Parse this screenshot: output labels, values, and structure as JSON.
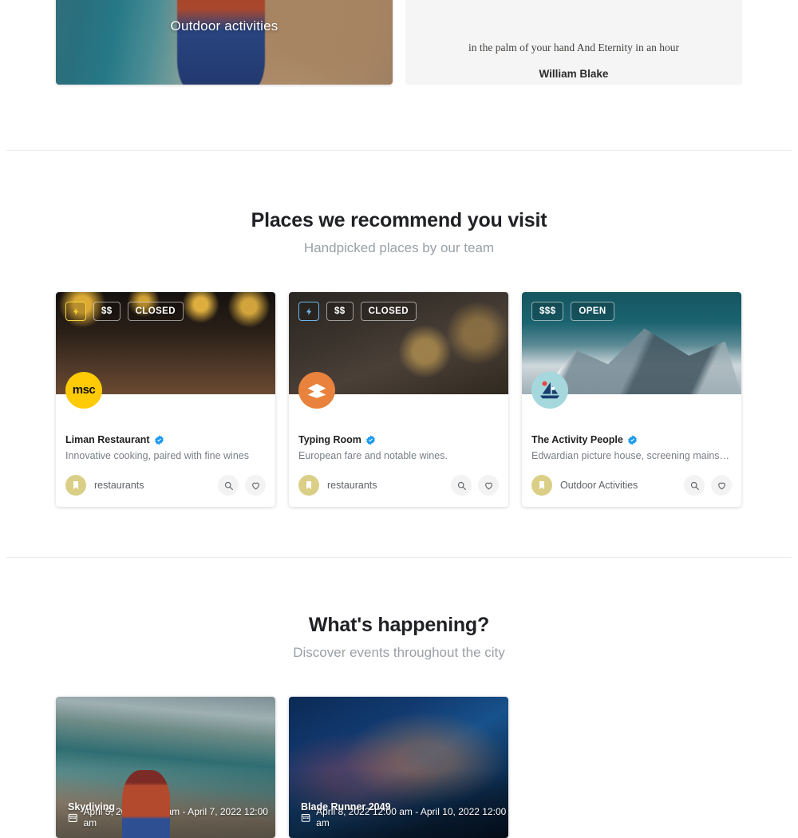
{
  "top": {
    "category_card": {
      "title": "Outdoor activities"
    },
    "quote": {
      "text": "in the palm of your hand And Eternity in an hour",
      "author": "William Blake"
    }
  },
  "places_section": {
    "title": "Places we recommend you visit",
    "subtitle": "Handpicked places by our team",
    "cards": [
      {
        "name": "Liman Restaurant",
        "description": "Innovative cooking, paired with fine wines",
        "category": "restaurants",
        "price": "$$",
        "status": "CLOSED",
        "has_bolt": true,
        "bolt_color": "#f2d43c",
        "avatar_text": "msc",
        "avatar_color": "#ffca06",
        "verified": true
      },
      {
        "name": "Typing Room",
        "description": "European fare and notable wines.",
        "category": "restaurants",
        "price": "$$",
        "status": "CLOSED",
        "has_bolt": true,
        "bolt_color": "#6cb6f0",
        "avatar_text": "",
        "avatar_color": "#e8823c",
        "verified": true
      },
      {
        "name": "The Activity People",
        "description": "Edwardian picture house, screening mainstream fil…",
        "category": "Outdoor Activities",
        "price": "$$$",
        "status": "OPEN",
        "has_bolt": false,
        "bolt_color": "",
        "avatar_text": "",
        "avatar_color": "#a5d8dd",
        "verified": true
      }
    ],
    "icons": {
      "bolt": "⚡",
      "search": "search-icon",
      "favorite": "heart-icon",
      "bookmark": "bookmark-icon"
    }
  },
  "events_section": {
    "title": "What's happening?",
    "subtitle": "Discover events throughout the city",
    "cards": [
      {
        "title": "Skydiving",
        "date": "April 5, 2022 12:00 am - April 7, 2022 12:00 am"
      },
      {
        "title": "Blade Runner 2049",
        "date": "April 8, 2022 12:00 am - April 10, 2022 12:00 am"
      }
    ]
  },
  "colors": {
    "verified_blue": "#1d9bf0",
    "divider": "#ececec",
    "muted_text": "#9aa0a6",
    "category_chip": "#dbcf87"
  }
}
